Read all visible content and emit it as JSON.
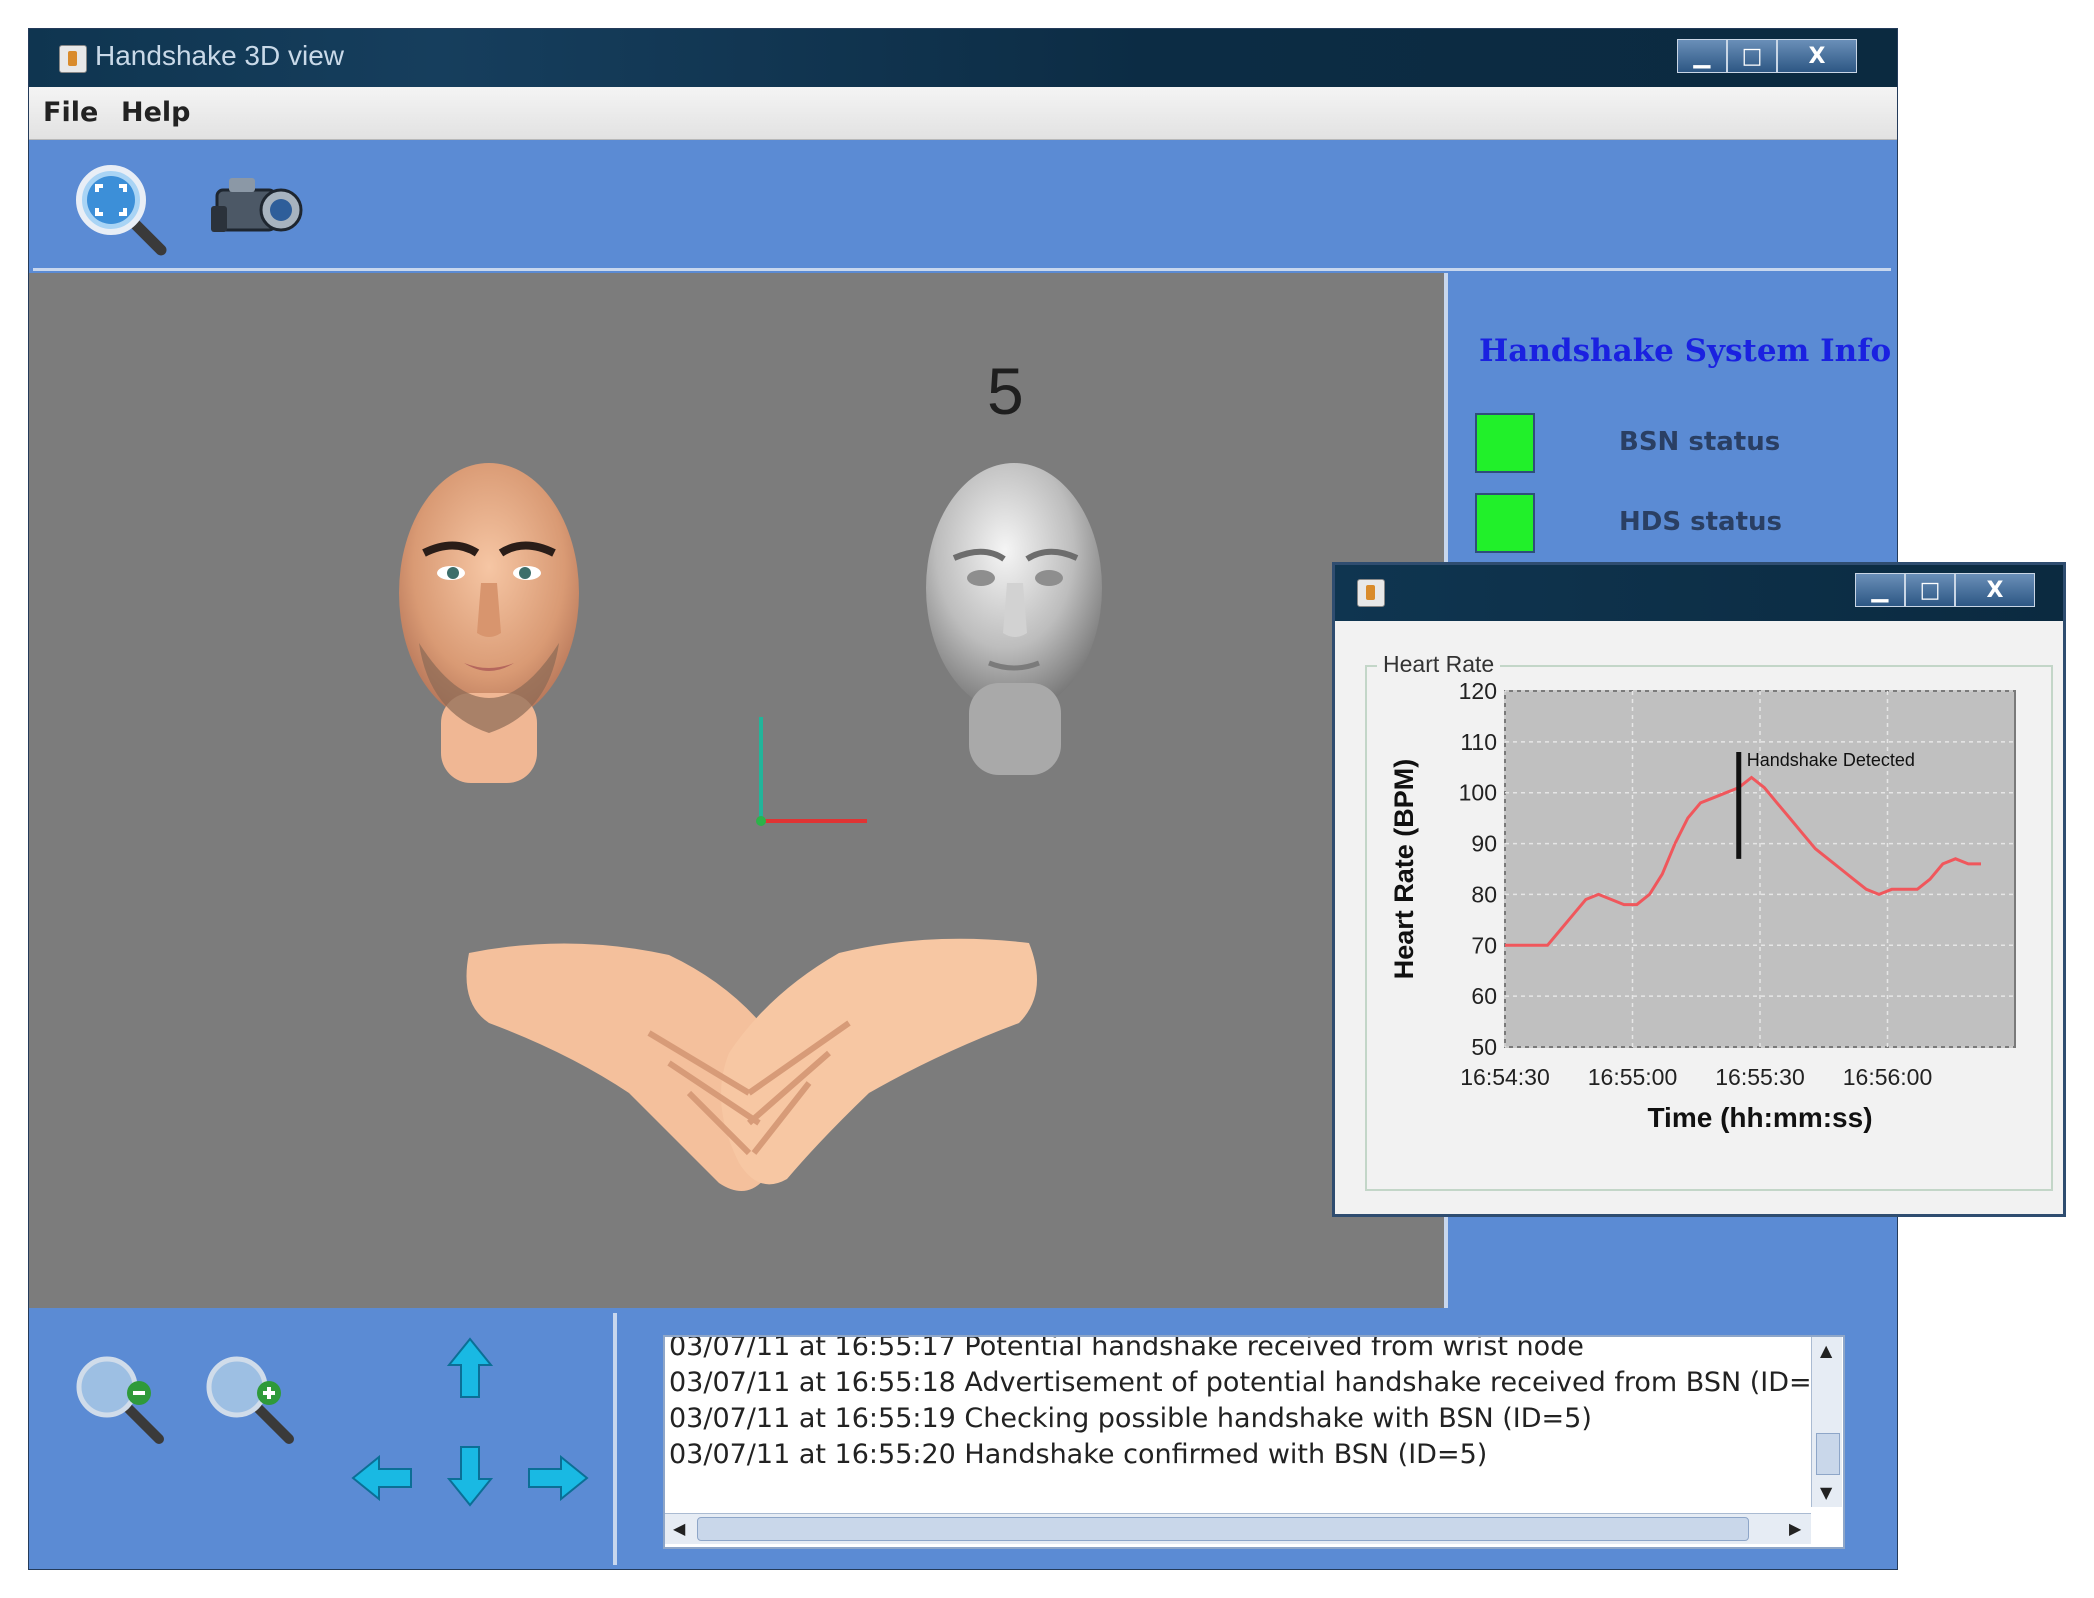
{
  "main_window": {
    "title": "Handshake 3D view",
    "controls": {
      "minimize": "▁",
      "maximize": "□",
      "close": "X"
    }
  },
  "menu": {
    "file": "File",
    "help": "Help"
  },
  "toolbar": {
    "icons": [
      "zoom-fit-icon",
      "camera-icon"
    ]
  },
  "view3d": {
    "counter": "5"
  },
  "info_panel": {
    "title": "Handshake System Info",
    "statuses": [
      {
        "label": "BSN status",
        "color": "#21f02a"
      },
      {
        "label": "HDS status",
        "color": "#21f02a"
      }
    ]
  },
  "navigation": {
    "icons": [
      "zoom-out-icon",
      "zoom-in-icon",
      "arrow-up-icon",
      "arrow-left-icon",
      "arrow-down-icon",
      "arrow-right-icon"
    ]
  },
  "log": {
    "lines": [
      "03/07/11 at 16:55:17 Potential handshake received from wrist node",
      "03/07/11 at 16:55:18 Advertisement of potential handshake received from BSN (ID=",
      "03/07/11 at 16:55:19 Checking possible handshake with BSN (ID=5)",
      "03/07/11 at 16:55:20 Handshake confirmed with BSN (ID=5)"
    ]
  },
  "chart_window": {
    "controls": {
      "minimize": "▁",
      "maximize": "□",
      "close": "X"
    },
    "frame_label": "Heart Rate"
  },
  "chart_data": {
    "type": "line",
    "title": "",
    "xlabel": "Time (hh:mm:ss)",
    "ylabel": "Heart Rate (BPM)",
    "ylim": [
      50,
      120
    ],
    "yticks": [
      "50",
      "60",
      "70",
      "80",
      "90",
      "100",
      "110",
      "120"
    ],
    "xticks": [
      "16:54:30",
      "16:55:00",
      "16:55:30",
      "16:56:00"
    ],
    "grid": true,
    "line_color": "#f0575c",
    "series": [
      {
        "x": [
          "16:54:30",
          "16:54:35",
          "16:54:40",
          "16:54:43",
          "16:54:46",
          "16:54:49",
          "16:54:52",
          "16:54:55",
          "16:54:58",
          "16:55:01",
          "16:55:04",
          "16:55:07",
          "16:55:10",
          "16:55:13",
          "16:55:16",
          "16:55:19",
          "16:55:22",
          "16:55:25",
          "16:55:28",
          "16:55:31",
          "16:55:34",
          "16:55:37",
          "16:55:40",
          "16:55:43",
          "16:55:46",
          "16:55:49",
          "16:55:52",
          "16:55:55",
          "16:55:58",
          "16:56:01",
          "16:56:04",
          "16:56:07",
          "16:56:10",
          "16:56:13",
          "16:56:16",
          "16:56:19",
          "16:56:22"
        ],
        "y": [
          70,
          70,
          70,
          73,
          76,
          79,
          80,
          79,
          78,
          78,
          80,
          84,
          90,
          95,
          98,
          99,
          100,
          101,
          103,
          101,
          98,
          95,
          92,
          89,
          87,
          85,
          83,
          81,
          80,
          81,
          81,
          81,
          83,
          86,
          87,
          86,
          86
        ]
      }
    ],
    "annotations": [
      {
        "text": "Handshake Detected",
        "x": "16:55:25",
        "y_range": [
          87,
          108
        ]
      }
    ]
  }
}
